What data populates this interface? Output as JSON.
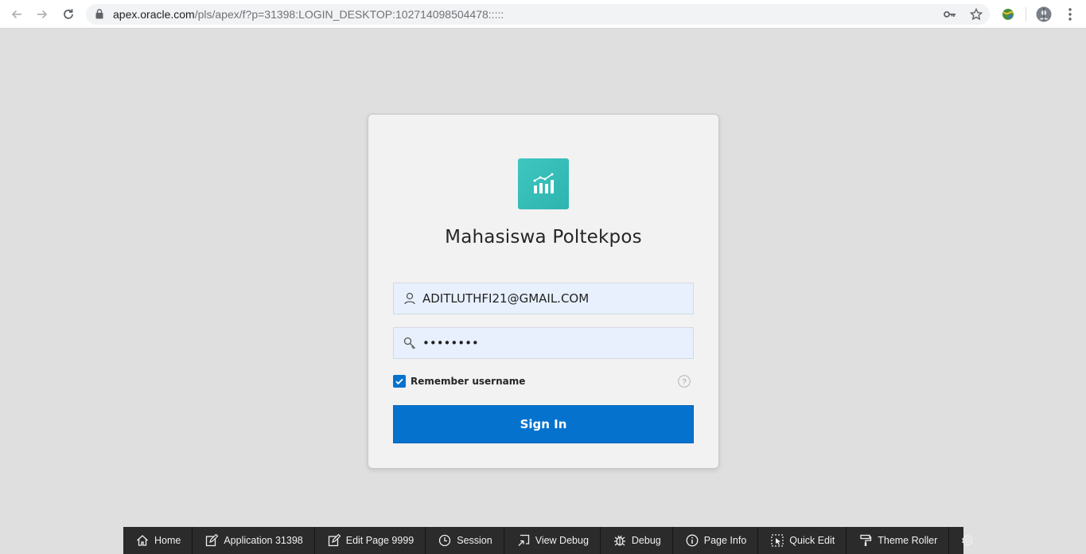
{
  "browser": {
    "url_host": "apex.oracle.com",
    "url_path": "/pls/apex/f?p=31398:LOGIN_DESKTOP:102714098504478:::::"
  },
  "login": {
    "app_title": "Mahasiswa Poltekpos",
    "username_value": "ADITLUTHFI21@GMAIL.COM",
    "password_value": "••••••••",
    "remember_label": "Remember username",
    "remember_checked": true,
    "sign_in_label": "Sign In",
    "accent_color": "#0572ce",
    "logo_color": "#3fc6c0"
  },
  "dev_toolbar": {
    "items": [
      {
        "label": "Home",
        "icon": "home-icon"
      },
      {
        "label": "Application 31398",
        "icon": "edit-square-icon"
      },
      {
        "label": "Edit Page 9999",
        "icon": "edit-icon"
      },
      {
        "label": "Session",
        "icon": "clock-icon"
      },
      {
        "label": "View Debug",
        "icon": "view-debug-icon"
      },
      {
        "label": "Debug",
        "icon": "bug-icon"
      },
      {
        "label": "Page Info",
        "icon": "info-icon"
      },
      {
        "label": "Quick Edit",
        "icon": "quick-edit-icon"
      },
      {
        "label": "Theme Roller",
        "icon": "paint-roller-icon"
      },
      {
        "label": "",
        "icon": "gear-icon"
      }
    ]
  }
}
